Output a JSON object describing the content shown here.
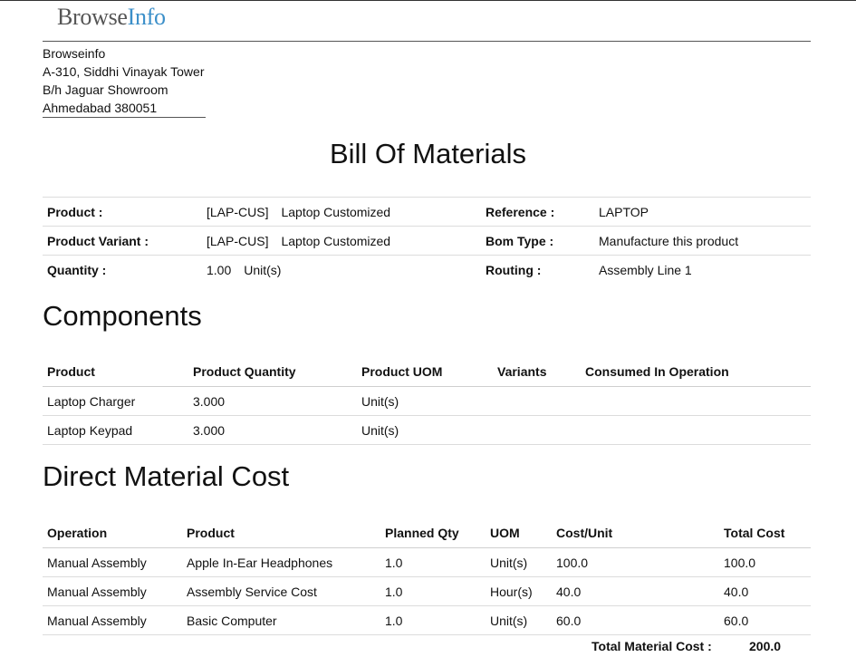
{
  "logo": {
    "part1": "Browse",
    "part2": "Info"
  },
  "company": {
    "lines": [
      "Browseinfo",
      "A-310, Siddhi Vinayak Tower",
      "B/h Jaguar Showroom",
      "Ahmedabad 380051"
    ]
  },
  "title": "Bill Of Materials",
  "info": {
    "product_label": "Product :",
    "product_code": "[LAP-CUS]",
    "product_name": "Laptop Customized",
    "reference_label": "Reference :",
    "reference_value": "LAPTOP",
    "variant_label": "Product Variant :",
    "variant_code": "[LAP-CUS]",
    "variant_name": "Laptop Customized",
    "bom_type_label": "Bom Type :",
    "bom_type_value": "Manufacture this product",
    "quantity_label": "Quantity :",
    "quantity_value": "1.00",
    "quantity_uom": "Unit(s)",
    "routing_label": "Routing :",
    "routing_value": "Assembly Line 1"
  },
  "components": {
    "heading": "Components",
    "headers": [
      "Product",
      "Product Quantity",
      "Product UOM",
      "Variants",
      "Consumed In Operation"
    ],
    "rows": [
      [
        "Laptop Charger",
        "3.000",
        "Unit(s)",
        "",
        ""
      ],
      [
        "Laptop Keypad",
        "3.000",
        "Unit(s)",
        "",
        ""
      ]
    ]
  },
  "material_cost": {
    "heading": "Direct Material Cost",
    "headers": [
      "Operation",
      "Product",
      "Planned Qty",
      "UOM",
      "Cost/Unit",
      "Total Cost"
    ],
    "rows": [
      [
        "Manual Assembly",
        "Apple In-Ear Headphones",
        "1.0",
        "Unit(s)",
        "100.0",
        "100.0"
      ],
      [
        "Manual Assembly",
        "Assembly Service Cost",
        "1.0",
        "Hour(s)",
        "40.0",
        "40.0"
      ],
      [
        "Manual Assembly",
        "Basic Computer",
        "1.0",
        "Unit(s)",
        "60.0",
        "60.0"
      ]
    ],
    "total_label": "Total Material Cost :",
    "total_value": "200.0"
  }
}
